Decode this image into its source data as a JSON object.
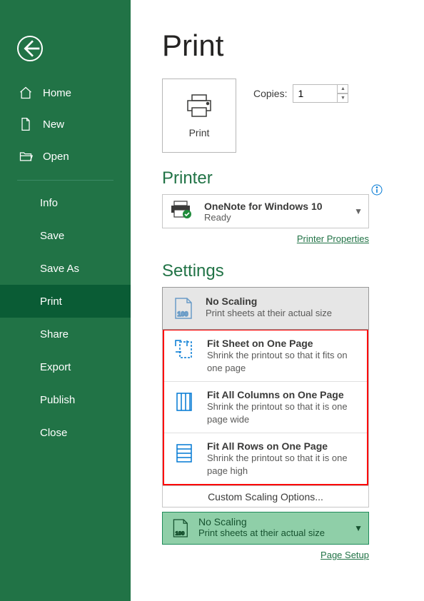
{
  "sidebar": {
    "items": [
      {
        "label": "Home",
        "icon": "home-icon"
      },
      {
        "label": "New",
        "icon": "new-icon"
      },
      {
        "label": "Open",
        "icon": "open-icon"
      }
    ],
    "sub_items": [
      {
        "label": "Info"
      },
      {
        "label": "Save"
      },
      {
        "label": "Save As"
      },
      {
        "label": "Print",
        "selected": true
      },
      {
        "label": "Share"
      },
      {
        "label": "Export"
      },
      {
        "label": "Publish"
      },
      {
        "label": "Close"
      }
    ]
  },
  "page_title": "Print",
  "print_button": {
    "label": "Print"
  },
  "copies": {
    "label": "Copies:",
    "value": "1"
  },
  "printer_section": {
    "title": "Printer",
    "selected": {
      "name": "OneNote for Windows 10",
      "status": "Ready"
    },
    "properties_link": "Printer Properties"
  },
  "settings_section": {
    "title": "Settings"
  },
  "scaling_options": [
    {
      "title": "No Scaling",
      "desc": "Print sheets at their actual size",
      "icon": "page-100-icon",
      "selected": true
    },
    {
      "title": "Fit Sheet on One Page",
      "desc": "Shrink the printout so that it fits on one page",
      "icon": "fit-sheet-icon"
    },
    {
      "title": "Fit All Columns on One Page",
      "desc": "Shrink the printout so that it is one page wide",
      "icon": "fit-columns-icon"
    },
    {
      "title": "Fit All Rows on One Page",
      "desc": "Shrink the printout so that it is one page high",
      "icon": "fit-rows-icon"
    }
  ],
  "custom_scaling_label": "Custom Scaling Options...",
  "current_scaling": {
    "title": "No Scaling",
    "desc": "Print sheets at their actual size",
    "icon": "page-100-icon"
  },
  "page_setup_link": "Page Setup"
}
